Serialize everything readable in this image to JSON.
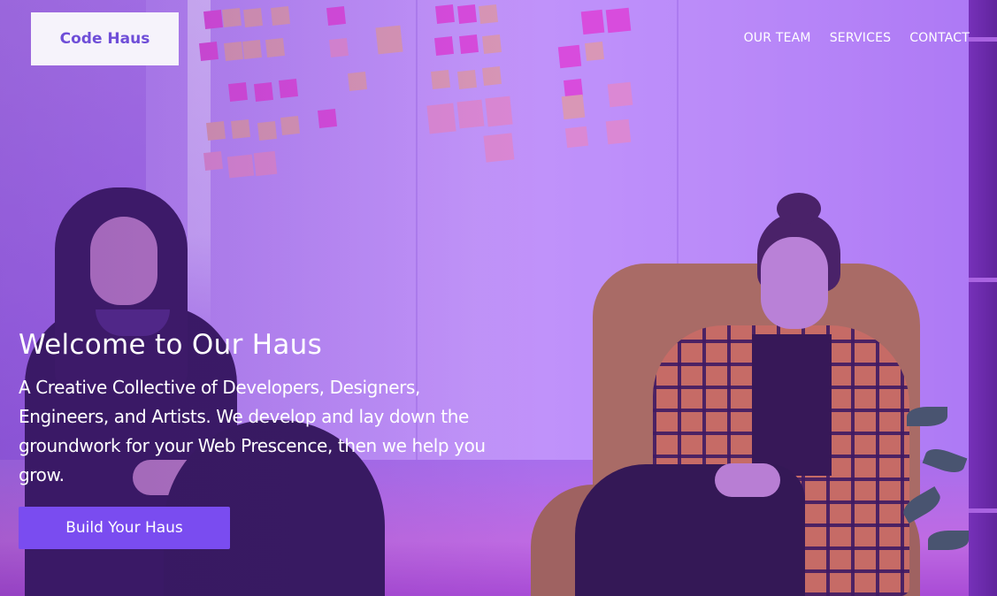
{
  "brand": {
    "name": "Code Haus"
  },
  "nav": {
    "items": [
      {
        "label": "OUR TEAM"
      },
      {
        "label": "SERVICES"
      },
      {
        "label": "CONTACT"
      }
    ]
  },
  "hero": {
    "title": "Welcome to Our Haus",
    "subtitle": "A Creative Collective of Developers, Designers, Engineers, and Artists. We develop and lay down the groundwork for your Web Prescence, then we help you grow.",
    "cta_label": "Build Your Haus"
  },
  "colors": {
    "accent": "#7a4cf0",
    "brand_text": "#6f4ed8",
    "overlay": "#9646ff"
  }
}
